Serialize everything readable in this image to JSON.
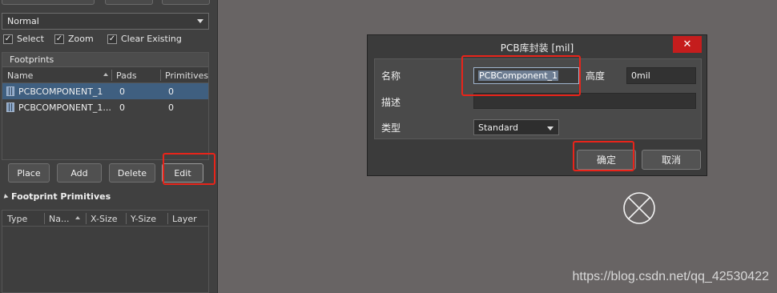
{
  "left_panel": {
    "mode_select": {
      "value": "Normal"
    },
    "checkboxes": [
      {
        "label": "Select",
        "checked": true
      },
      {
        "label": "Zoom",
        "checked": true
      },
      {
        "label": "Clear Existing",
        "checked": true
      }
    ],
    "footprints": {
      "title": "Footprints",
      "columns": [
        "Name",
        "Pads",
        "Primitives"
      ],
      "rows": [
        {
          "name": "PCBCOMPONENT_1",
          "pads": "0",
          "primitives": "0",
          "selected": true
        },
        {
          "name": "PCBCOMPONENT_1...",
          "pads": "0",
          "primitives": "0",
          "selected": false
        }
      ]
    },
    "buttons": {
      "place": "Place",
      "add": "Add",
      "delete": "Delete",
      "edit": "Edit"
    },
    "primitives": {
      "title": "Footprint Primitives",
      "columns": [
        "Type",
        "Na...",
        "X-Size",
        "Y-Size",
        "Layer"
      ]
    }
  },
  "dialog": {
    "title": "PCB库封装 [mil]",
    "close_icon": "close-icon",
    "name_label": "名称",
    "name_value": "PCBComponent_1",
    "height_label": "高度",
    "height_value": "0mil",
    "desc_label": "描述",
    "desc_value": "",
    "type_label": "类型",
    "type_value": "Standard",
    "ok_label": "确定",
    "cancel_label": "取消"
  },
  "canvas": {
    "origin_icon": "origin-marker-icon",
    "watermark": "https://blog.csdn.net/qq_42530422"
  },
  "colors": {
    "canvas_bg": "#686464",
    "panel_bg": "#404040",
    "selection": "#3f5f80",
    "highlight_red": "#e8241a",
    "close_red": "#c51d1d"
  }
}
